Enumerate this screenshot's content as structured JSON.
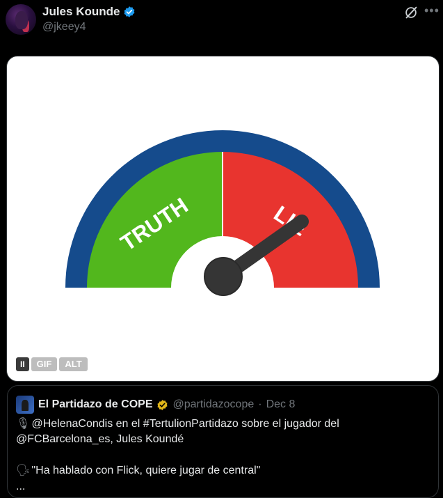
{
  "author": {
    "name": "Jules Kounde",
    "handle": "@jkeey4"
  },
  "icons": {
    "verified": "verified-badge-icon",
    "grok": "grok-icon",
    "more": "more-options-icon"
  },
  "media": {
    "gauge_left_label": "TRUTH",
    "gauge_right_label": "LIE",
    "needle_level": 0.85,
    "colors": {
      "outer": "#154b8c",
      "truth": "#52b71d",
      "lie": "#e8342f",
      "needle": "#353535"
    },
    "controls": {
      "pause": "II",
      "gif": "GIF",
      "alt": "ALT"
    }
  },
  "quote": {
    "name": "El Partidazo de COPE",
    "handle": "@partidazocope",
    "separator": "·",
    "date": "Dec 8",
    "line1_emoji": "🎙",
    "line1": "@HelenaCondis en el #TertulionPartidazo sobre el jugador del",
    "line2": "@FCBarcelona_es, Jules Koundé",
    "line3_emoji": "🗣",
    "line3": "\"Ha hablado con Flick, quiere jugar de central\"",
    "line4": "..."
  }
}
